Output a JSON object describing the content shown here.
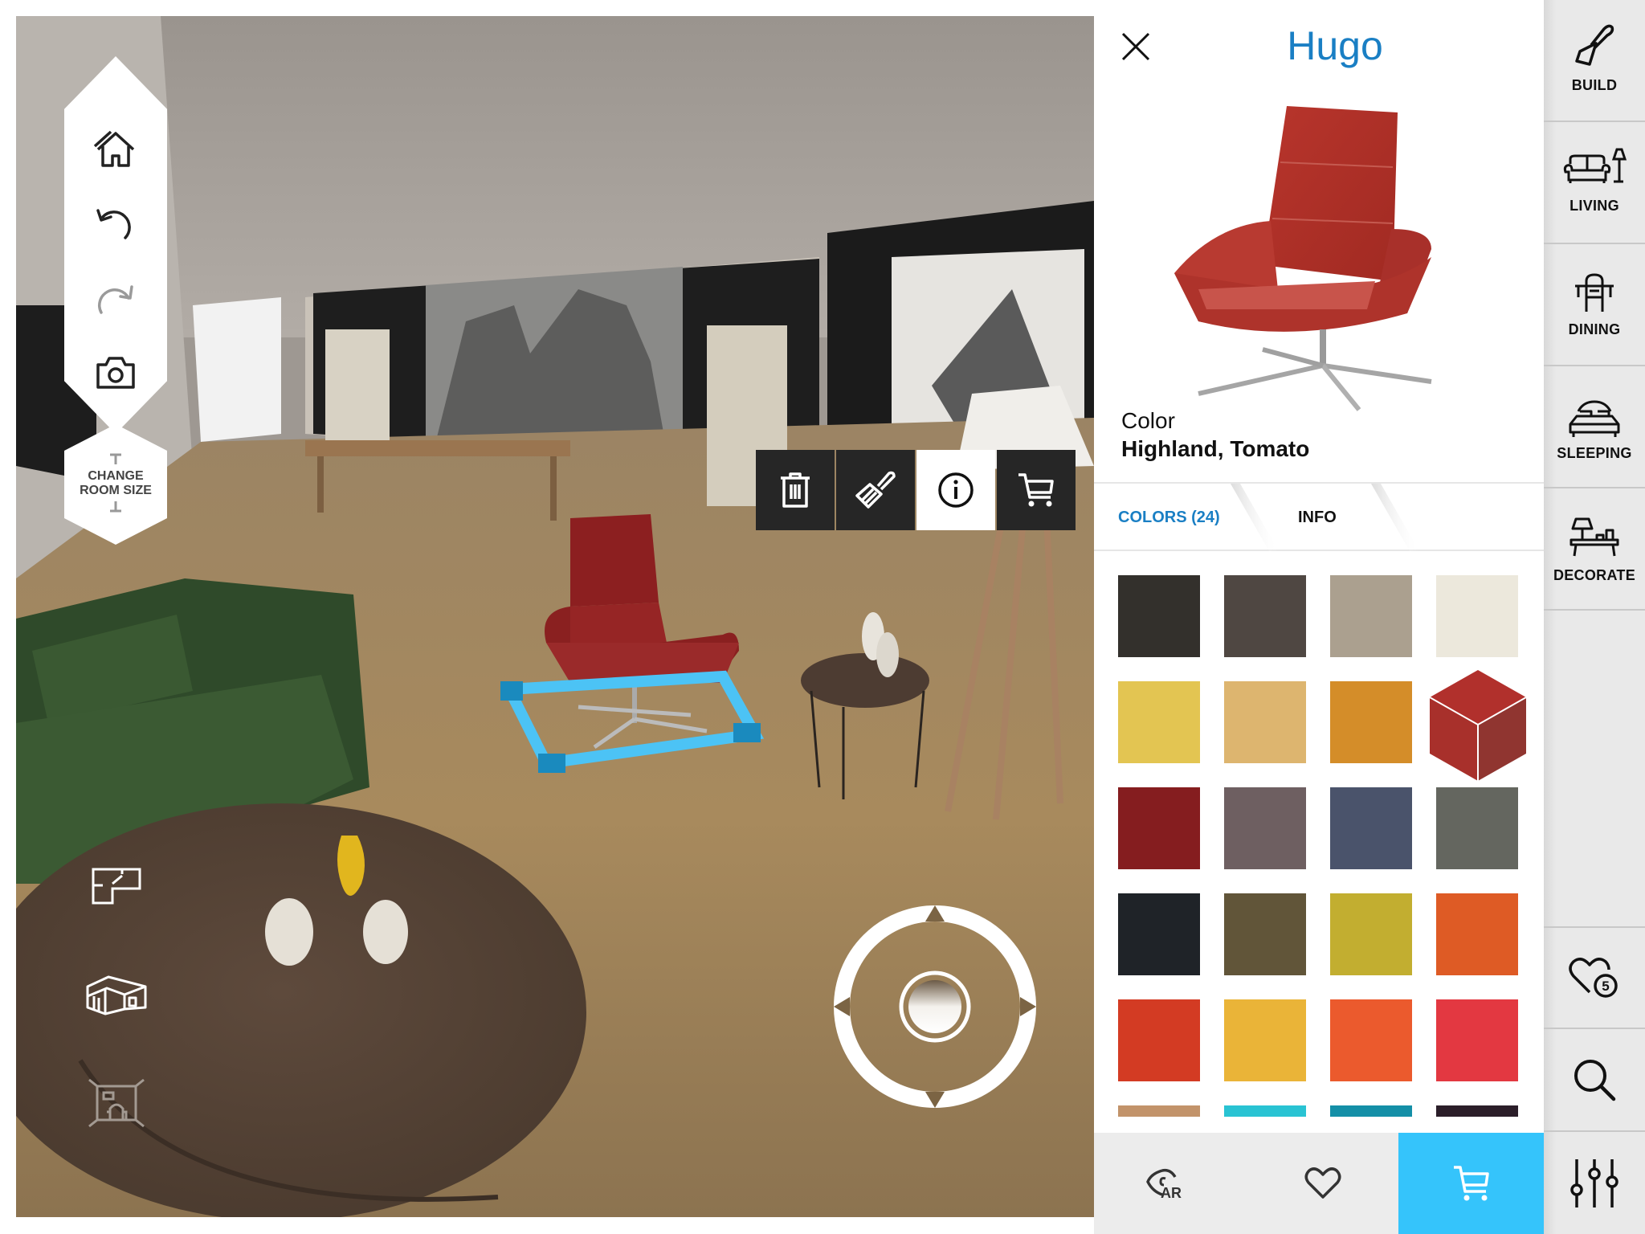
{
  "scene": {
    "left_toolbar": {
      "tools": [
        {
          "name": "home",
          "icon": "home-icon",
          "enabled": true
        },
        {
          "name": "undo",
          "icon": "undo-icon",
          "enabled": true
        },
        {
          "name": "redo",
          "icon": "redo-icon",
          "enabled": false
        },
        {
          "name": "screenshot",
          "icon": "camera-icon",
          "enabled": true
        }
      ],
      "room_size_label_line1": "CHANGE",
      "room_size_label_line2": "ROOM SIZE"
    },
    "view_buttons": [
      {
        "name": "2d-floorplan-view",
        "icon": "floorplan-icon"
      },
      {
        "name": "3d-overview",
        "icon": "3d-house-icon"
      },
      {
        "name": "first-person-view",
        "icon": "room-view-icon",
        "dimmed": true
      }
    ],
    "context_toolbar": [
      {
        "name": "delete",
        "icon": "trash-icon",
        "active": false
      },
      {
        "name": "paint",
        "icon": "paintbrush-icon",
        "active": false
      },
      {
        "name": "info",
        "icon": "info-icon",
        "active": true
      },
      {
        "name": "cart",
        "icon": "cart-icon",
        "active": false
      }
    ],
    "selection_color": "#4cc3f5"
  },
  "panel": {
    "title": "Hugo",
    "color_label": "Color",
    "color_value": "Highland, Tomato",
    "tabs": [
      {
        "label": "COLORS (24)",
        "active": true
      },
      {
        "label": "INFO",
        "active": false
      }
    ],
    "swatches": [
      "#33302c",
      "#4f4742",
      "#aba08f",
      "#ece8dc",
      "#e3c552",
      "#ddb56f",
      "#d48d29",
      "#b1302c",
      "#851d1f",
      "#6e5f61",
      "#4a536b",
      "#64665f",
      "#1f2328",
      "#615539",
      "#c2ae30",
      "#de5b25",
      "#d33b23",
      "#eab438",
      "#eb5a2d",
      "#e33841",
      "#c2936a",
      "#29c3d3",
      "#148fa7",
      "#2b1e29"
    ],
    "selected_swatch_index": 7,
    "bottom_actions": [
      {
        "name": "view-in-ar",
        "icon": "ar-eye-icon",
        "label": "AR"
      },
      {
        "name": "add-to-favorites",
        "icon": "heart-icon"
      },
      {
        "name": "add-to-cart",
        "icon": "cart-icon"
      }
    ],
    "accent": "#1a7fc4",
    "cart_color": "#35c4fb"
  },
  "rail": {
    "categories": [
      {
        "label": "BUILD",
        "icon": "trowel-icon"
      },
      {
        "label": "LIVING",
        "icon": "sofa-lamp-icon"
      },
      {
        "label": "DINING",
        "icon": "dining-table-icon"
      },
      {
        "label": "SLEEPING",
        "icon": "bed-icon"
      },
      {
        "label": "DECORATE",
        "icon": "decorate-icon"
      }
    ],
    "favorites_count": "5"
  }
}
